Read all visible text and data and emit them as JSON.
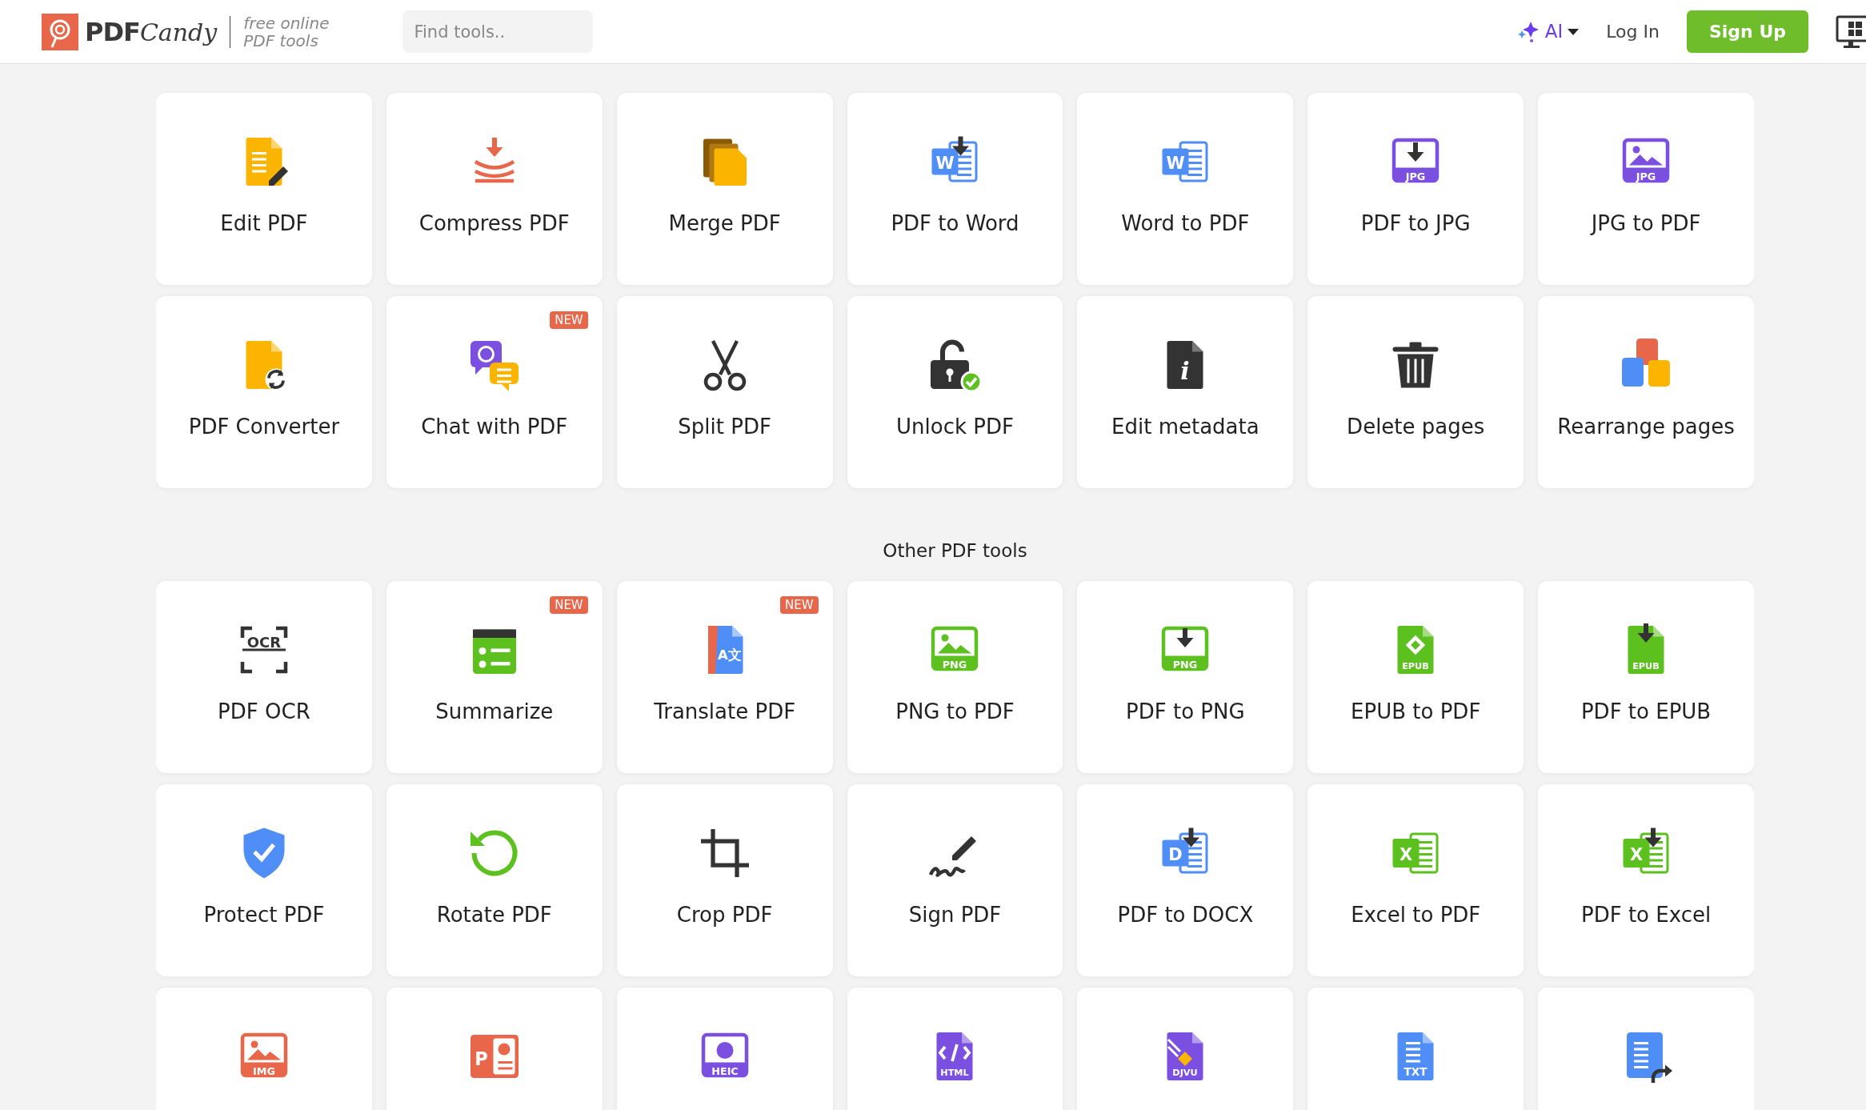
{
  "header": {
    "brand": {
      "strong": "PDF",
      "script": "Candy"
    },
    "tagline": [
      "free online",
      "PDF tools"
    ],
    "search": {
      "placeholder": "Find tools.."
    },
    "ai_menu": {
      "label": "AI"
    },
    "login": "Log In",
    "signup": "Sign Up"
  },
  "sections": [
    {
      "tools": [
        {
          "label": "Edit PDF",
          "new": false
        },
        {
          "label": "Compress PDF",
          "new": false
        },
        {
          "label": "Merge PDF",
          "new": false
        },
        {
          "label": "PDF to Word",
          "new": false,
          "icon_text": "W"
        },
        {
          "label": "Word to PDF",
          "new": false,
          "icon_text": "W"
        },
        {
          "label": "PDF to JPG",
          "new": false,
          "icon_text": "JPG"
        },
        {
          "label": "JPG to PDF",
          "new": false,
          "icon_text": "JPG"
        },
        {
          "label": "PDF Converter",
          "new": false
        },
        {
          "label": "Chat with PDF",
          "new": true,
          "badge": "NEW"
        },
        {
          "label": "Split PDF",
          "new": false
        },
        {
          "label": "Unlock PDF",
          "new": false
        },
        {
          "label": "Edit metadata",
          "new": false,
          "icon_text": "i"
        },
        {
          "label": "Delete pages",
          "new": false
        },
        {
          "label": "Rearrange pages",
          "new": false
        }
      ]
    },
    {
      "title": "Other PDF tools",
      "tools": [
        {
          "label": "PDF OCR",
          "new": false,
          "icon_text": "OCR"
        },
        {
          "label": "Summarize",
          "new": true,
          "badge": "NEW"
        },
        {
          "label": "Translate PDF",
          "new": true,
          "badge": "NEW",
          "icon_text": "A文"
        },
        {
          "label": "PNG to PDF",
          "new": false,
          "icon_text": "PNG"
        },
        {
          "label": "PDF to PNG",
          "new": false,
          "icon_text": "PNG"
        },
        {
          "label": "EPUB to PDF",
          "new": false,
          "icon_text": "EPUB"
        },
        {
          "label": "PDF to EPUB",
          "new": false,
          "icon_text": "EPUB"
        },
        {
          "label": "Protect PDF",
          "new": false
        },
        {
          "label": "Rotate PDF",
          "new": false
        },
        {
          "label": "Crop PDF",
          "new": false
        },
        {
          "label": "Sign PDF",
          "new": false
        },
        {
          "label": "PDF to DOCX",
          "new": false,
          "icon_text": "D"
        },
        {
          "label": "Excel to PDF",
          "new": false,
          "icon_text": "X"
        },
        {
          "label": "PDF to Excel",
          "new": false,
          "icon_text": "X"
        },
        {
          "new": false,
          "icon_text": "IMG"
        },
        {
          "new": false,
          "icon_text": "P"
        },
        {
          "new": false,
          "icon_text": "HEIC"
        },
        {
          "new": false,
          "icon_text": "HTML"
        },
        {
          "new": false,
          "icon_text": "DJVU"
        },
        {
          "new": false,
          "icon_text": "TXT"
        },
        {
          "new": false
        }
      ]
    }
  ]
}
